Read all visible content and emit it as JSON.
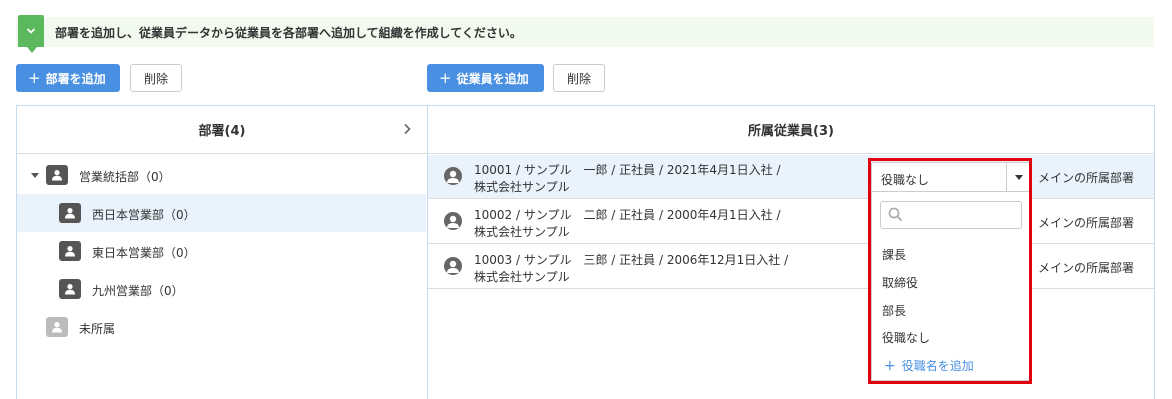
{
  "banner": {
    "icon": "chevron-down-icon",
    "text": "部署を追加し、従業員データから従業員を各部署へ追加して組織を作成してください。"
  },
  "toolbar_left": {
    "add_label": "部署を追加",
    "delete_label": "削除"
  },
  "toolbar_right": {
    "add_label": "従業員を追加",
    "delete_label": "削除"
  },
  "departments_panel": {
    "title": "部署(4)",
    "items": [
      {
        "label": "営業統括部（0）"
      },
      {
        "label": "西日本営業部（0）"
      },
      {
        "label": "東日本営業部（0）"
      },
      {
        "label": "九州営業部（0）"
      },
      {
        "label": "未所属"
      }
    ]
  },
  "employees_panel": {
    "title": "所属従業員(3)",
    "rows": [
      {
        "line1": "10001 / サンプル　一郎 / 正社員 / 2021年4月1日入社 /",
        "line2": "株式会社サンプル",
        "main": "メインの所属部署"
      },
      {
        "line1": "10002 / サンプル　二郎 / 正社員 / 2000年4月1日入社 /",
        "line2": "株式会社サンプル",
        "main": "メインの所属部署"
      },
      {
        "line1": "10003 / サンプル　三郎 / 正社員 / 2006年12月1日入社 /",
        "line2": "株式会社サンプル",
        "main": "メインの所属部署"
      }
    ]
  },
  "position_select": {
    "value": "役職なし",
    "options": [
      {
        "label": "課長"
      },
      {
        "label": "取締役"
      },
      {
        "label": "部長"
      },
      {
        "label": "役職なし"
      }
    ],
    "add_label": "役職名を追加"
  },
  "colors": {
    "primary": "#4a90e2",
    "banner_bg": "#f2faf0",
    "banner_tab": "#5cb85c",
    "selected_row": "#eaf3fc",
    "highlight": "#e0000f"
  }
}
